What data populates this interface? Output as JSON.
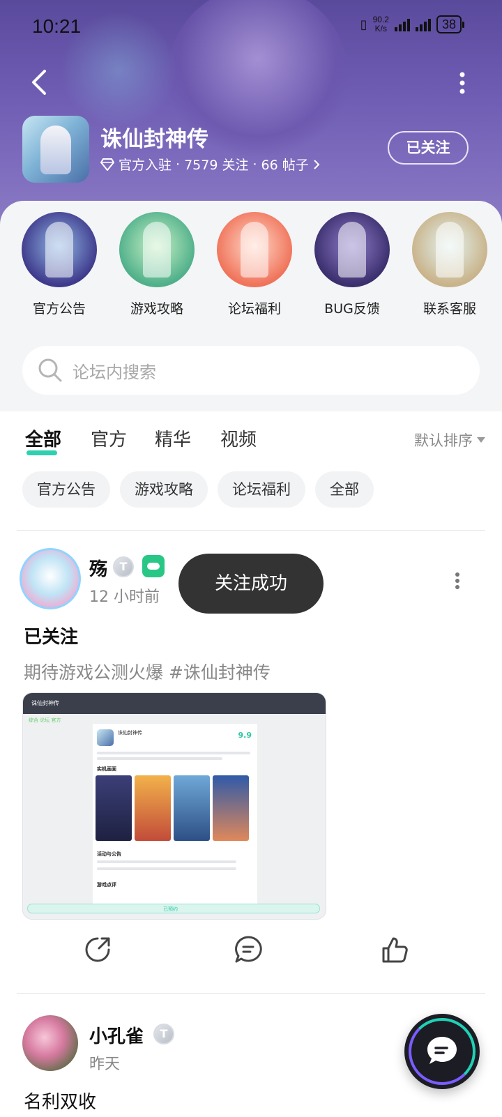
{
  "status_bar": {
    "time": "10:21",
    "net_speed_value": "90.2",
    "net_speed_unit": "K/s",
    "battery": "38"
  },
  "forum": {
    "title": "诛仙封神传",
    "verified": "官方入驻",
    "followers": "7579 关注",
    "posts": "66 帖子",
    "follow_label": "已关注"
  },
  "shortcuts": [
    {
      "label": "官方公告",
      "color": "#3f3a8c"
    },
    {
      "label": "游戏攻略",
      "color": "#4fb08a"
    },
    {
      "label": "论坛福利",
      "color": "#f0735a"
    },
    {
      "label": "BUG反馈",
      "color": "#3b2f6e"
    },
    {
      "label": "联系客服",
      "color": "#c9b38a"
    }
  ],
  "search": {
    "placeholder": "论坛内搜索"
  },
  "tabs": [
    "全部",
    "官方",
    "精华",
    "视频"
  ],
  "sort_label": "默认排序",
  "chips": [
    "官方公告",
    "游戏攻略",
    "论坛福利",
    "全部"
  ],
  "toast": "关注成功",
  "posts": [
    {
      "author": "殇",
      "time": "12 小时前",
      "badge": "T",
      "title": "已关注",
      "body": "期待游戏公测火爆 #诛仙封神传",
      "screenshot": {
        "app_title": "诛仙封神传",
        "nav": "综合  论坛  官方",
        "game_name": "诛仙封神传",
        "score": "9.9",
        "section_screens": "实机画面",
        "section_events": "活动与公告",
        "section_reviews": "游戏点评",
        "reserved": "已预约"
      }
    },
    {
      "author": "小孔雀",
      "time": "昨天",
      "badge": "T",
      "title": "名利双收"
    }
  ],
  "colors": {
    "accent": "#2ed0b0",
    "header": "#6e5cb3",
    "toast_bg": "#333333"
  },
  "icons": [
    "back-icon",
    "more-icon",
    "diamond-icon",
    "search-icon",
    "share-icon",
    "comment-icon",
    "like-icon",
    "chat-icon"
  ]
}
